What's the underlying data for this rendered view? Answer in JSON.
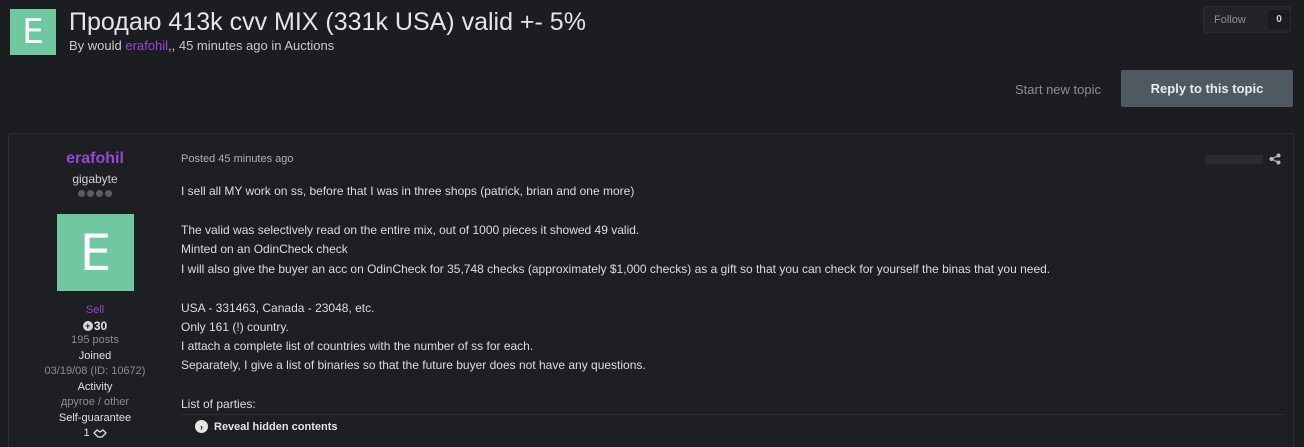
{
  "topic": {
    "avatar_letter": "E",
    "title": "Продаю 413k cvv MIX (331k USA) valid +- 5%",
    "meta_prefix": "By would ",
    "meta_author": "erafohil",
    "meta_suffix": ",, 45 minutes ago in Auctions"
  },
  "follow": {
    "label": "Follow",
    "count": "0"
  },
  "actions": {
    "start_new_topic": "Start new topic",
    "reply": "Reply to this topic"
  },
  "author": {
    "name": "erafohil",
    "title": "gigabyte",
    "avatar_letter": "E",
    "group": "Sell",
    "reputation": "30",
    "posts": "195 posts",
    "joined_label": "Joined",
    "joined_value": "03/19/08 (ID: 10672)",
    "activity_label": "Activity",
    "activity_value": "другое / other",
    "guarantee_label": "Self-guarantee",
    "guarantee_value": "1"
  },
  "post": {
    "posted": "Posted 45 minutes ago",
    "lines": [
      "I sell all MY work on ss, before that I was in three shops (patrick, brian and one more)",
      "The valid was selectively read on the entire mix, out of 1000 pieces it showed 49 valid.",
      "Minted on an OdinCheck check",
      "I will also give the buyer an acc on OdinCheck for 35,748 checks (approximately $1,000 checks) as a gift so that you can check for yourself the binas that you need.",
      "USA - 331463, Canada - 23048, etc.",
      "Only 161 (!) country.",
      "I attach a complete list of countries with the number of ss for each.",
      "Separately, I give a list of binaries so that the future buyer does not have any questions.",
      "List of parties:"
    ],
    "reveal": "Reveal hidden contents"
  },
  "colors": {
    "accent": "#9747d6",
    "avatar": "#6fc8a0",
    "reply_button": "#4f5962",
    "background": "#1c1d21"
  },
  "icons": [
    "share-icon",
    "reputation-icon",
    "handshake-icon",
    "chevron-right-icon"
  ]
}
